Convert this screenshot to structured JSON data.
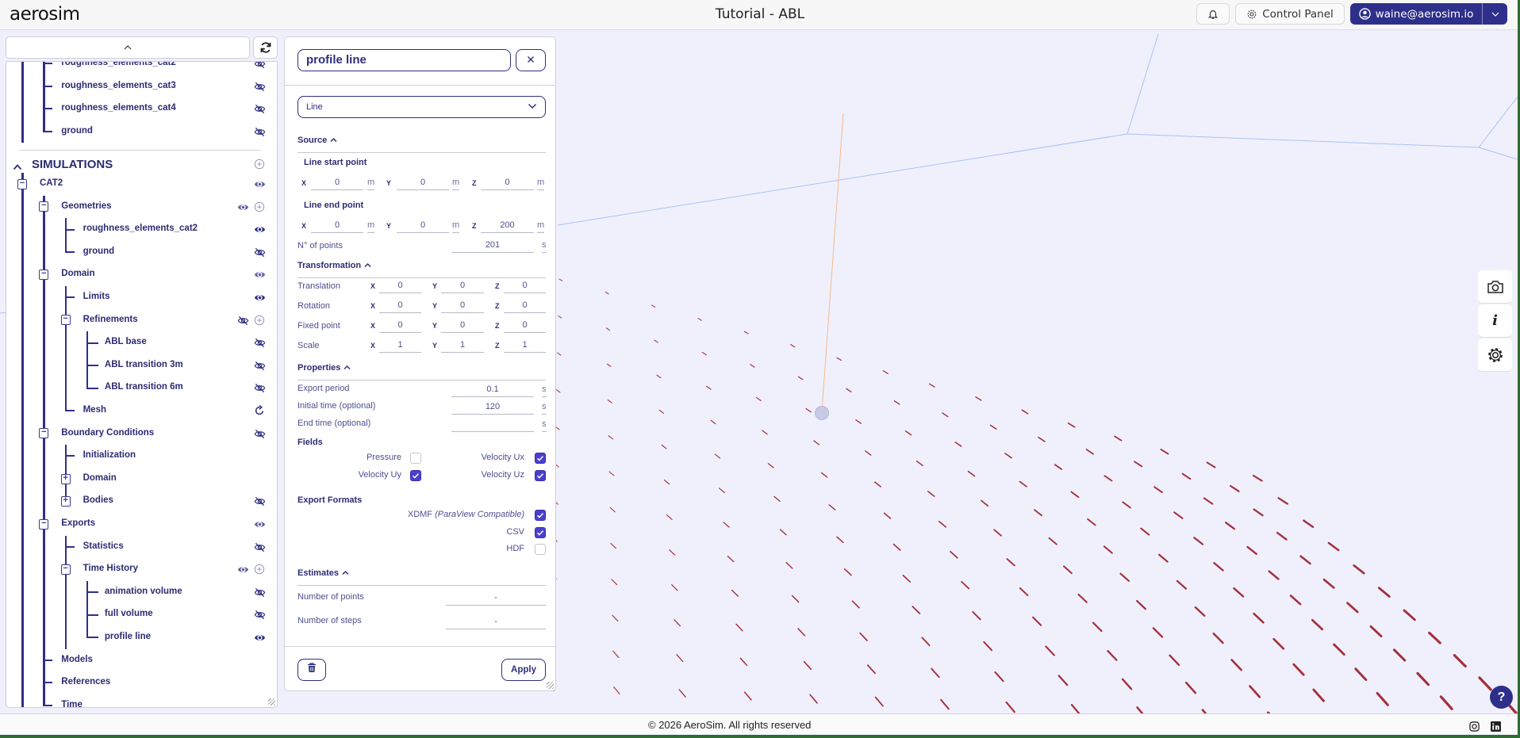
{
  "header": {
    "logo": "aerosim",
    "title": "Tutorial - ABL",
    "notifications_icon": "bell-icon",
    "control_panel": "Control Panel",
    "user": "waine@aerosim.io"
  },
  "colors": {
    "accent": "#2e2f8a",
    "checkbox": "#4b3fd0",
    "viewport_bg": "#f0f0fd",
    "roughness": "#9b1c25"
  },
  "tree": {
    "rows": [
      {
        "label": "roughness_elements_cat2",
        "level": 2,
        "icons": [
          "eye-off"
        ]
      },
      {
        "label": "roughness_elements_cat3",
        "level": 2,
        "icons": [
          "eye-off"
        ]
      },
      {
        "label": "roughness_elements_cat4",
        "level": 2,
        "icons": [
          "eye-off"
        ]
      },
      {
        "label": "ground",
        "level": 2,
        "icons": [
          "eye-off"
        ]
      },
      {
        "header": "SIMULATIONS",
        "level": 0,
        "icons": [
          "add"
        ]
      },
      {
        "label": "CAT2",
        "level": 1,
        "toggle": "minus",
        "icons": [
          "eye-muted"
        ]
      },
      {
        "label": "Geometries",
        "level": 2,
        "toggle": "minus",
        "icons": [
          "eye-muted",
          "add"
        ]
      },
      {
        "label": "roughness_elements_cat2",
        "level": 3,
        "icons": [
          "eye"
        ]
      },
      {
        "label": "ground",
        "level": 3,
        "icons": [
          "eye-off"
        ]
      },
      {
        "label": "Domain",
        "level": 2,
        "toggle": "minus",
        "icons": [
          "eye-muted"
        ]
      },
      {
        "label": "Limits",
        "level": 3,
        "icons": [
          "eye"
        ]
      },
      {
        "label": "Refinements",
        "level": 3,
        "toggle": "minus",
        "icons": [
          "eye-off",
          "add"
        ]
      },
      {
        "label": "ABL base",
        "level": 4,
        "icons": [
          "eye-off"
        ]
      },
      {
        "label": "ABL transition 3m",
        "level": 4,
        "icons": [
          "eye-off"
        ]
      },
      {
        "label": "ABL transition 6m",
        "level": 4,
        "icons": [
          "eye-off"
        ]
      },
      {
        "label": "Mesh",
        "level": 3,
        "icons": [
          "refresh"
        ]
      },
      {
        "label": "Boundary Conditions",
        "level": 2,
        "toggle": "minus",
        "icons": [
          "eye-off"
        ]
      },
      {
        "label": "Initialization",
        "level": 3,
        "icons": []
      },
      {
        "label": "Domain",
        "level": 3,
        "toggle": "plus",
        "icons": []
      },
      {
        "label": "Bodies",
        "level": 3,
        "toggle": "plus",
        "icons": [
          "eye-off"
        ]
      },
      {
        "label": "Exports",
        "level": 2,
        "toggle": "minus",
        "icons": [
          "eye-muted"
        ]
      },
      {
        "label": "Statistics",
        "level": 3,
        "icons": [
          "eye-off"
        ]
      },
      {
        "label": "Time History",
        "level": 3,
        "toggle": "minus",
        "icons": [
          "eye-muted",
          "add"
        ]
      },
      {
        "label": "animation volume",
        "level": 4,
        "icons": [
          "eye-off"
        ]
      },
      {
        "label": "full volume",
        "level": 4,
        "icons": [
          "eye-off"
        ]
      },
      {
        "label": "profile line",
        "level": 4,
        "icons": [
          "eye"
        ]
      },
      {
        "label": "Models",
        "level": 2,
        "icons": []
      },
      {
        "label": "References",
        "level": 2,
        "icons": []
      },
      {
        "label": "Time",
        "level": 2,
        "icons": []
      }
    ]
  },
  "panel": {
    "name": "profile line",
    "type": "Line",
    "axes": [
      "X",
      "Y",
      "Z"
    ],
    "source": {
      "title": "Source",
      "start_label": "Line start point",
      "start": [
        "0",
        "0",
        "0"
      ],
      "end_label": "Line end point",
      "end": [
        "0",
        "0",
        "200"
      ],
      "unit": "m",
      "n_points_label": "N° of points",
      "n_points": "201",
      "n_points_unit": "s"
    },
    "transformation": {
      "title": "Transformation",
      "rows": [
        {
          "label": "Translation",
          "values": [
            "0",
            "0",
            "0"
          ]
        },
        {
          "label": "Rotation",
          "values": [
            "0",
            "0",
            "0"
          ]
        },
        {
          "label": "Fixed point",
          "values": [
            "0",
            "0",
            "0"
          ]
        },
        {
          "label": "Scale",
          "values": [
            "1",
            "1",
            "1"
          ]
        }
      ]
    },
    "properties": {
      "title": "Properties",
      "rows": [
        {
          "label": "Export period",
          "value": "0.1",
          "unit": "s"
        },
        {
          "label": "Initial time (optional)",
          "value": "120",
          "unit": "s"
        },
        {
          "label": "End time (optional)",
          "value": "",
          "unit": "s"
        }
      ]
    },
    "fields": {
      "title": "Fields",
      "items": [
        {
          "label": "Pressure",
          "checked": false
        },
        {
          "label": "Velocity Ux",
          "checked": true
        },
        {
          "label": "Velocity Uy",
          "checked": true
        },
        {
          "label": "Velocity Uz",
          "checked": true
        }
      ]
    },
    "export_formats": {
      "title": "Export Formats",
      "items": [
        {
          "label": "XDMF",
          "note": "(ParaView Compatible)",
          "checked": true
        },
        {
          "label": "CSV",
          "note": "",
          "checked": true
        },
        {
          "label": "HDF",
          "note": "",
          "checked": false
        }
      ]
    },
    "estimates": {
      "title": "Estimates",
      "rows": [
        {
          "label": "Number of points",
          "value": "-"
        },
        {
          "label": "Number of steps",
          "value": "-"
        }
      ]
    },
    "apply": "Apply"
  },
  "viewport_tools": [
    "camera-icon",
    "info-icon",
    "gear-icon"
  ],
  "help": "?",
  "footer": {
    "copyright": "© 2026 AeroSim. All rights reserved",
    "social": [
      "instagram-icon",
      "linkedin-icon"
    ]
  }
}
